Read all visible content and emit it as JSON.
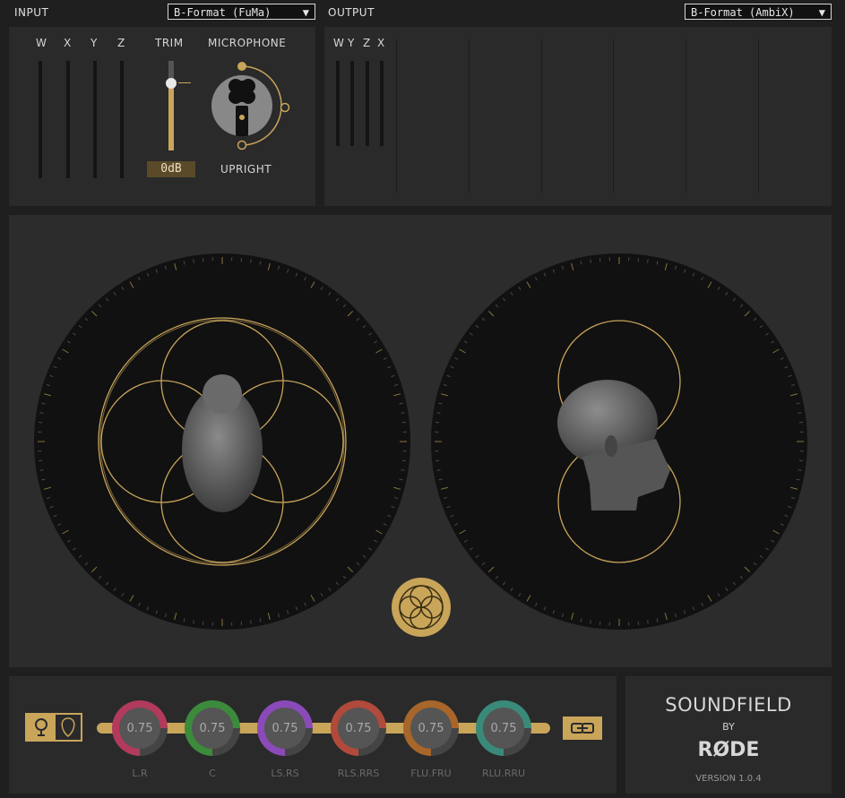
{
  "input": {
    "header": "INPUT",
    "format": "B-Format (FuMa)",
    "meters": [
      "W",
      "X",
      "Y",
      "Z"
    ],
    "trim_label": "TRIM",
    "trim_value": "0dB",
    "trim_level": 0.76,
    "mic_label": "MICROPHONE",
    "mic_orientation": "UPRIGHT"
  },
  "output": {
    "header": "OUTPUT",
    "format": "B-Format (AmbiX)",
    "meters": [
      "W",
      "Y",
      "Z",
      "X"
    ]
  },
  "dropdown_arrow": "▼",
  "colors": {
    "accent": "#c9a55a",
    "bg": "#1f1f1f",
    "panel": "#2a2a2a"
  },
  "decoders": [
    {
      "label": "L.R",
      "value": "0.75",
      "color": "#b23a5c"
    },
    {
      "label": "C",
      "value": "0.75",
      "color": "#3c8a3c"
    },
    {
      "label": "LS.RS",
      "value": "0.75",
      "color": "#8a4ab8"
    },
    {
      "label": "RLS.RRS",
      "value": "0.75",
      "color": "#b04a3a"
    },
    {
      "label": "FLU.FRU",
      "value": "0.75",
      "color": "#a8662a"
    },
    {
      "label": "RLU.RRU",
      "value": "0.75",
      "color": "#3a8a7a"
    }
  ],
  "brand": {
    "title": "SOUNDFIELD",
    "by": "BY",
    "name": "RØDE",
    "version": "VERSION 1.0.4"
  },
  "icons": [
    "mic-pattern-icon",
    "cardioid-icon",
    "link-icon",
    "soundfield-logo-icon",
    "microphone-icon"
  ]
}
